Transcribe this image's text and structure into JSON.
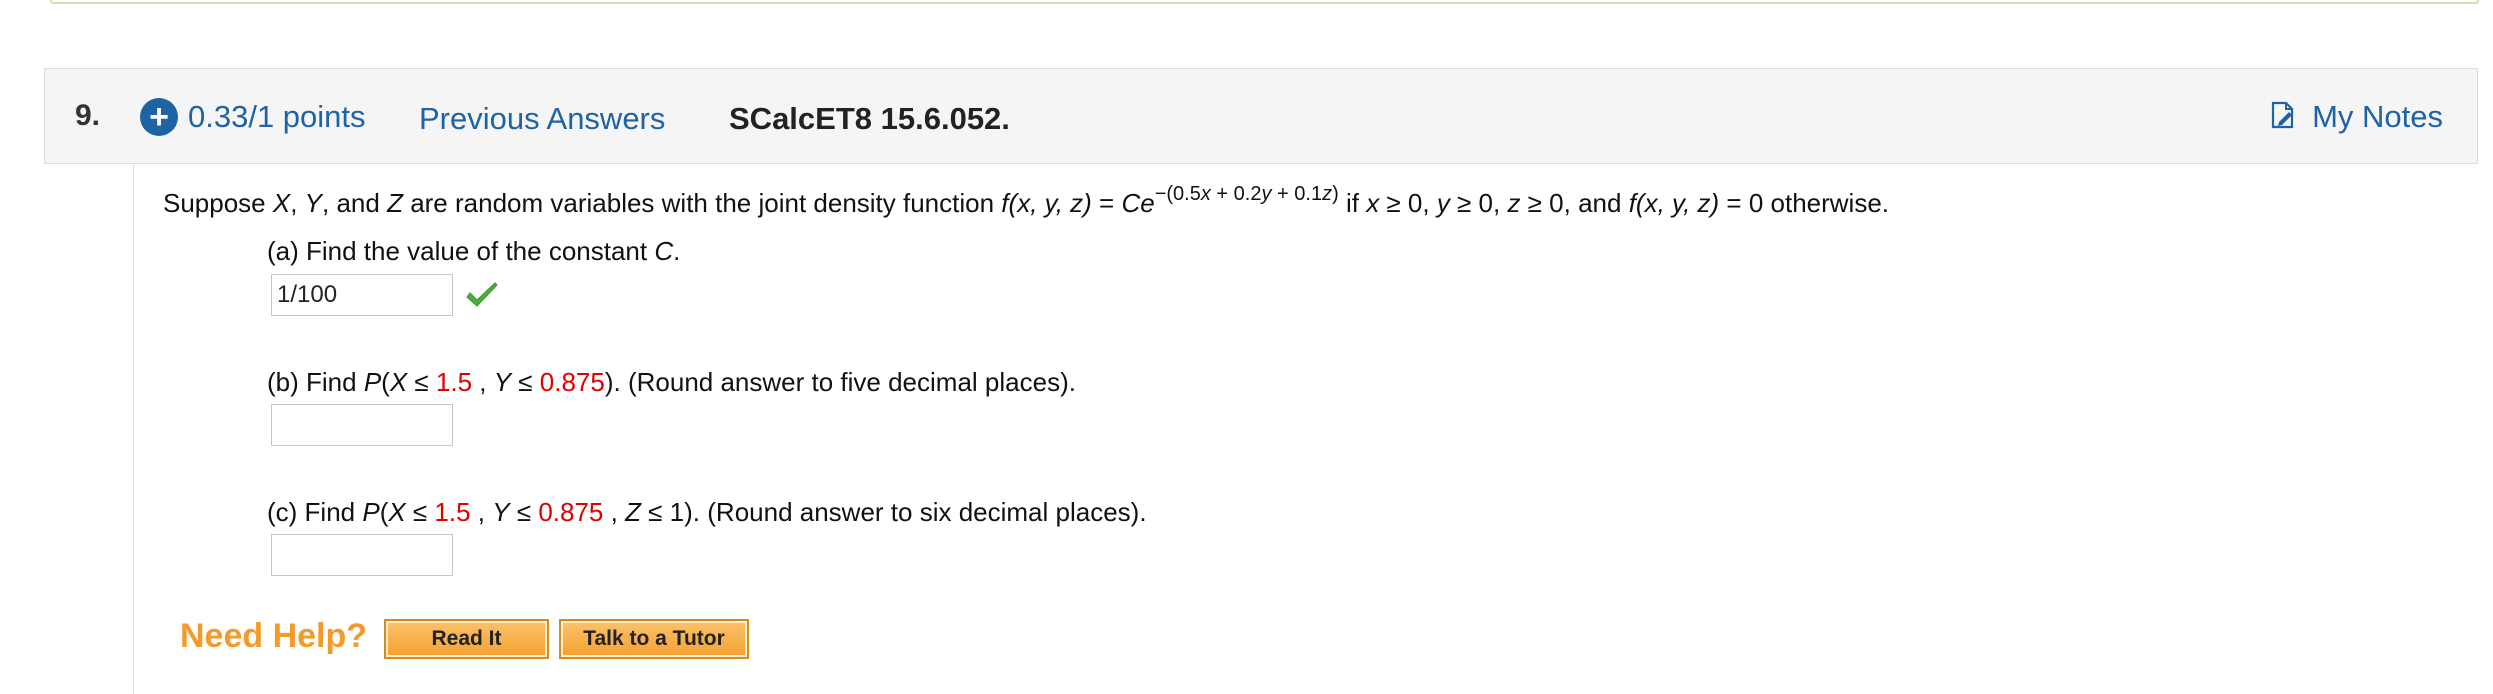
{
  "question": {
    "number": "9.",
    "points": "0.33/1 points",
    "previous_answers": "Previous Answers",
    "source": "SCalcET8 15.6.052.",
    "my_notes": "My Notes"
  },
  "statement": {
    "s1": "Suppose ",
    "X": "X",
    "c1": ", ",
    "Y": "Y",
    "c2": ", and ",
    "Z": "Z",
    "s2": " are random variables with the joint density function  ",
    "fxyz": "f",
    "args": "(x, y, z)",
    "eq": " = ",
    "C": "C",
    "e": "e",
    "exp_a": "−(0.5",
    "exp_x": "x",
    "exp_b": " + 0.2",
    "exp_y": "y",
    "exp_c": " + 0.1",
    "exp_z": "z",
    "exp_d": ")",
    "s3": " if ",
    "x": "x",
    "ge1": " ≥ 0, ",
    "y": "y",
    "ge2": " ≥ 0, ",
    "z": "z",
    "ge3": " ≥ 0, and ",
    "f2": "f",
    "args2": "(x, y, z)",
    "s4": " = 0 otherwise."
  },
  "part_a": {
    "pre": "(a) Find the value of the constant ",
    "C": "C",
    "post": ".",
    "answer": "1/100"
  },
  "part_b": {
    "pre": "(b) Find ",
    "P": "P",
    "open": "(",
    "X": "X",
    "le1": " ≤ ",
    "v1": "1.5",
    "sep": " , ",
    "Y": "Y",
    "le2": " ≤ ",
    "v2": "0.875",
    "close": ").",
    "post": " (Round answer to five decimal places).",
    "answer": ""
  },
  "part_c": {
    "pre": "(c) Find ",
    "P": "P",
    "open": "(",
    "X": "X",
    "le1": " ≤ ",
    "v1": "1.5",
    "sep1": " , ",
    "Y": "Y",
    "le2": " ≤ ",
    "v2": "0.875",
    "sep2": " , ",
    "Z": "Z",
    "le3": " ≤ 1",
    "close": ").",
    "post": " (Round answer to six decimal places).",
    "answer": ""
  },
  "help": {
    "label": "Need Help?",
    "read_it": "Read It",
    "talk_tutor": "Talk to a Tutor"
  },
  "colors": {
    "link_blue": "#1e63a3",
    "highlight_red": "#e00000",
    "help_orange": "#f39a2a",
    "correct_green": "#4caf3c"
  }
}
